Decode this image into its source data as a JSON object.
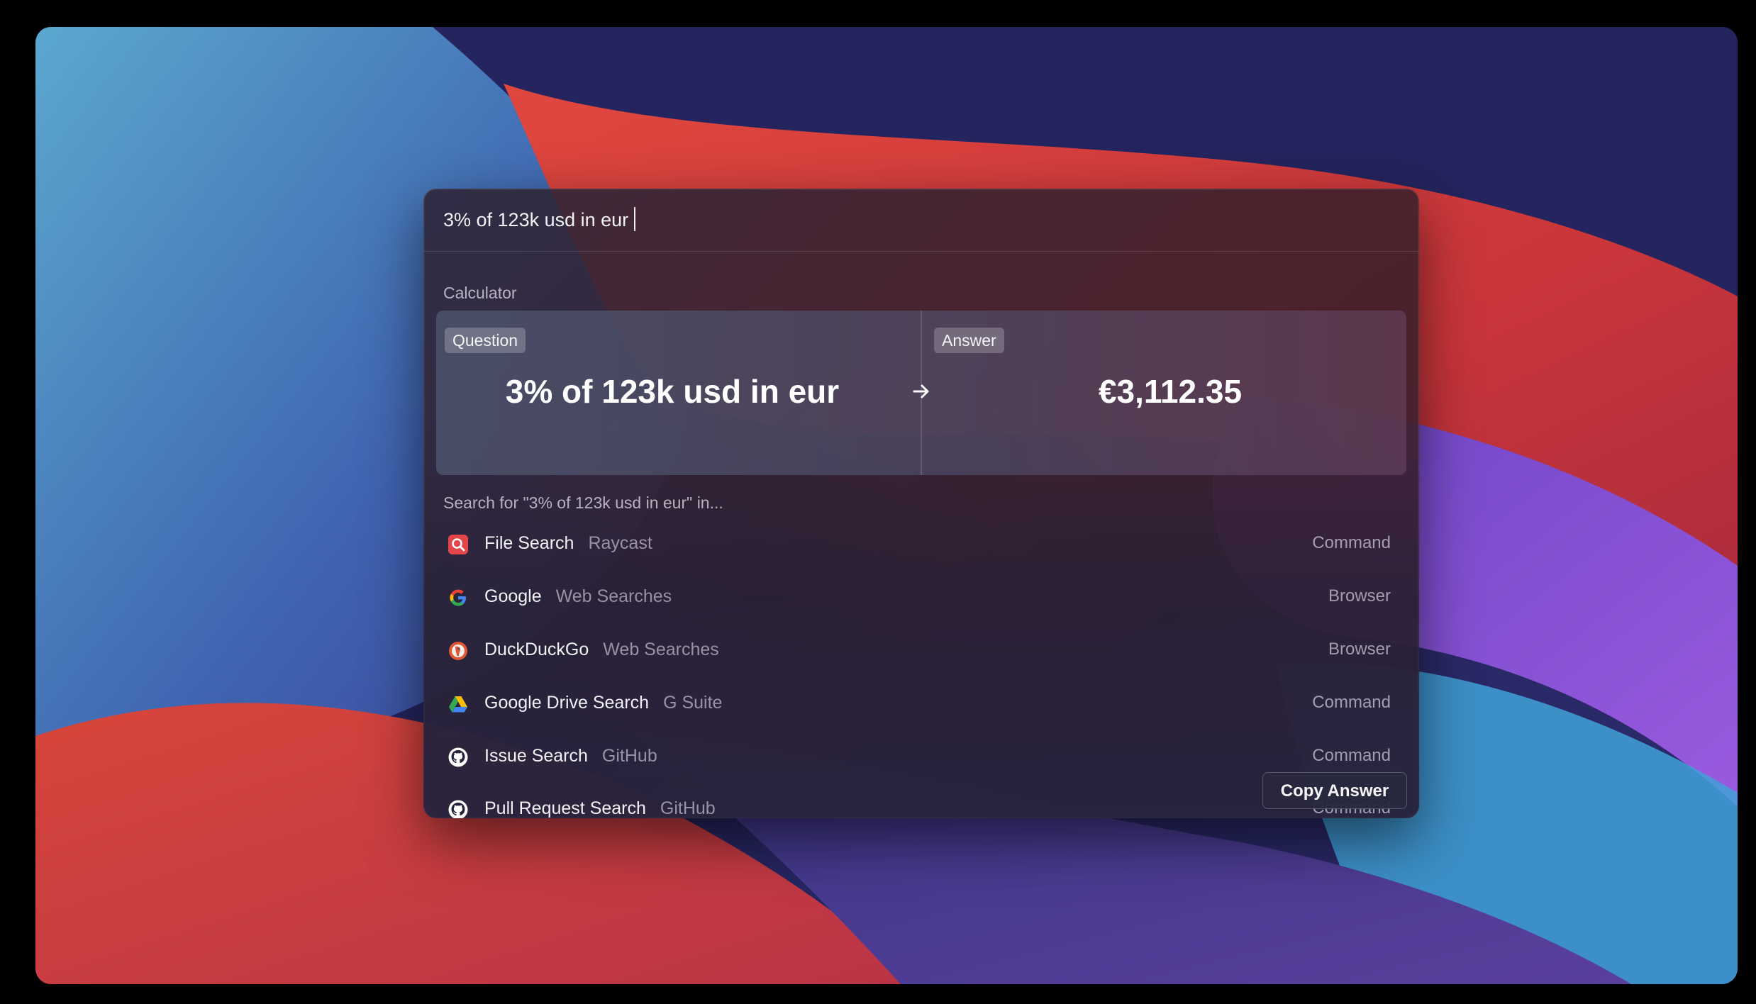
{
  "search": {
    "value": "3% of 123k usd in eur",
    "placeholder": ""
  },
  "calculator": {
    "section_label": "Calculator",
    "question_tag": "Question",
    "answer_tag": "Answer",
    "question": "3% of 123k usd in eur",
    "answer": "€3,112.35"
  },
  "results": {
    "section_label": "Search for \"3% of 123k usd in eur\" in...",
    "items": [
      {
        "title": "File Search",
        "subtitle": "Raycast",
        "accessory": "Command",
        "icon": "file-search-icon"
      },
      {
        "title": "Google",
        "subtitle": "Web Searches",
        "accessory": "Browser",
        "icon": "google-icon"
      },
      {
        "title": "DuckDuckGo",
        "subtitle": "Web Searches",
        "accessory": "Browser",
        "icon": "duckduckgo-icon"
      },
      {
        "title": "Google Drive Search",
        "subtitle": "G Suite",
        "accessory": "Command",
        "icon": "google-drive-icon"
      },
      {
        "title": "Issue Search",
        "subtitle": "GitHub",
        "accessory": "Command",
        "icon": "github-icon"
      },
      {
        "title": "Pull Request Search",
        "subtitle": "GitHub",
        "accessory": "Command",
        "icon": "github-icon"
      }
    ]
  },
  "action": {
    "copy_label": "Copy Answer"
  },
  "colors": {
    "file_search_red": "#e2454a",
    "google_blue": "#4285f4",
    "duckduckgo_orange": "#de5833"
  }
}
